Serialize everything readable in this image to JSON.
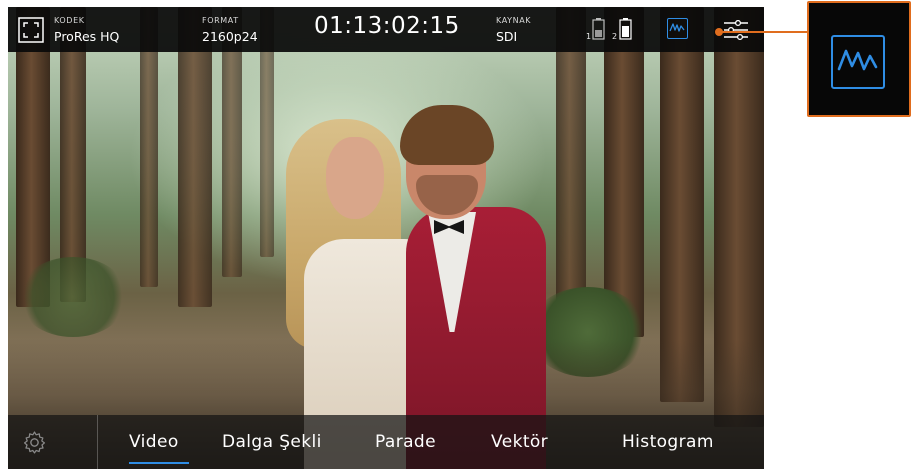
{
  "topbar": {
    "codec": {
      "label": "KODEK",
      "value": "ProRes HQ"
    },
    "format": {
      "label": "FORMAT",
      "value": "2160p24"
    },
    "timecode": "01:13:02:15",
    "source": {
      "label": "KAYNAK",
      "value": "SDI"
    },
    "batteries": [
      {
        "slot": "1"
      },
      {
        "slot": "2"
      }
    ]
  },
  "menu": {
    "tabs": [
      "Video",
      "Dalga Şekli",
      "Parade",
      "Vektör",
      "Histogram"
    ],
    "active_tab": "Video"
  },
  "colors": {
    "accent": "#2f8de4",
    "callout": "#e06d1e"
  }
}
